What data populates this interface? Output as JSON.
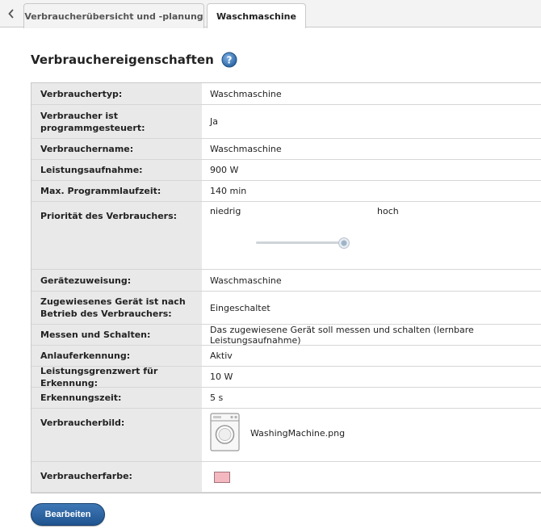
{
  "tabs": [
    {
      "label": "Verbraucherübersicht und -planung",
      "active": false
    },
    {
      "label": "Waschmaschine",
      "active": true
    }
  ],
  "heading": {
    "title": "Verbrauchereigenschaften"
  },
  "properties": {
    "verbrauchertyp": {
      "label": "Verbrauchertyp:",
      "value": "Waschmaschine"
    },
    "programmgesteuert": {
      "label": "Verbraucher ist programmgesteuert:",
      "value": "Ja"
    },
    "verbrauchername": {
      "label": "Verbrauchername:",
      "value": "Waschmaschine"
    },
    "leistungsaufnahme": {
      "label": "Leistungsaufnahme:",
      "value": "900 W"
    },
    "programmlaufzeit": {
      "label": "Max. Programmlaufzeit:",
      "value": "140 min"
    },
    "prioritaet": {
      "label": "Priorität des Verbrauchers:",
      "low_label": "niedrig",
      "high_label": "hoch",
      "level": 0.95
    },
    "geraetezuweisung": {
      "label": "Gerätezuweisung:",
      "value": "Waschmaschine"
    },
    "nach_betrieb": {
      "label": "Zugewiesenes Gerät ist nach Betrieb des Verbrauchers:",
      "value": "Eingeschaltet"
    },
    "messen_schalten": {
      "label": "Messen und Schalten:",
      "value": "Das zugewiesene Gerät soll messen und schalten (lernbare Leistungsaufnahme)"
    },
    "anlauferkennung": {
      "label": "Anlauferkennung:",
      "value": "Aktiv"
    },
    "grenzwert": {
      "label": "Leistungsgrenzwert für Erkennung:",
      "value": "10 W"
    },
    "erkennungszeit": {
      "label": "Erkennungszeit:",
      "value": "5 s"
    },
    "bild": {
      "label": "Verbraucherbild:",
      "filename": "WashingMachine.png",
      "icon": "washing-machine-icon"
    },
    "farbe": {
      "label": "Verbraucherfarbe:",
      "color": "#f4b8c0"
    }
  },
  "buttons": {
    "edit_label": "Bearbeiten"
  },
  "colors": {
    "accent": "#2b65a3",
    "help": "#3b7fc4"
  }
}
